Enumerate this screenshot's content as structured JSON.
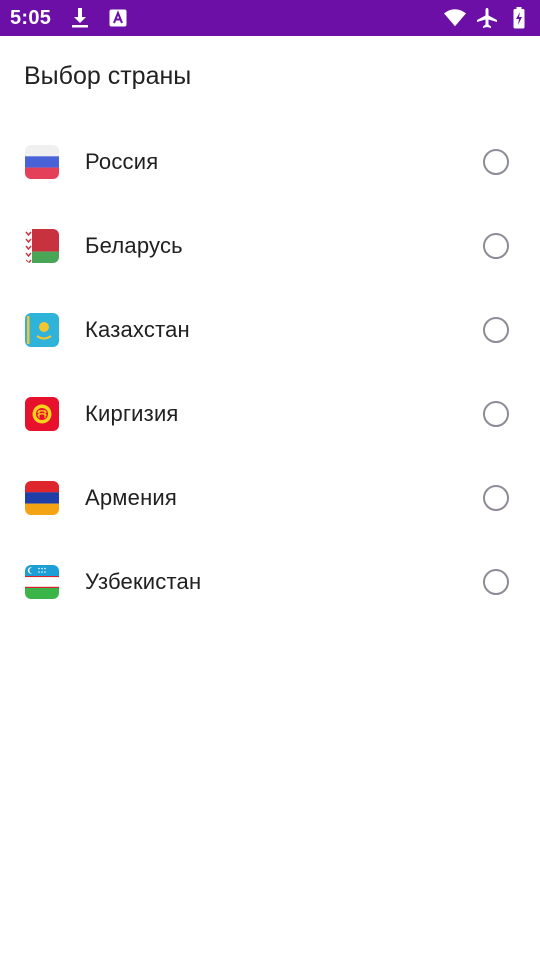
{
  "status_bar": {
    "time": "5:05",
    "icons_left": [
      "download-icon",
      "app-a-icon"
    ],
    "icons_right": [
      "wifi-icon",
      "airplane-icon",
      "battery-charging-icon"
    ],
    "color": "#6b0fa6"
  },
  "screen": {
    "title": "Выбор страны"
  },
  "countries": [
    {
      "label": "Россия",
      "flag": "russia-flag-icon",
      "selected": false
    },
    {
      "label": "Беларусь",
      "flag": "belarus-flag-icon",
      "selected": false
    },
    {
      "label": "Казахстан",
      "flag": "kazakhstan-flag-icon",
      "selected": false
    },
    {
      "label": "Киргизия",
      "flag": "kyrgyzstan-flag-icon",
      "selected": false
    },
    {
      "label": "Армения",
      "flag": "armenia-flag-icon",
      "selected": false
    },
    {
      "label": "Узбекистан",
      "flag": "uzbekistan-flag-icon",
      "selected": false
    }
  ]
}
